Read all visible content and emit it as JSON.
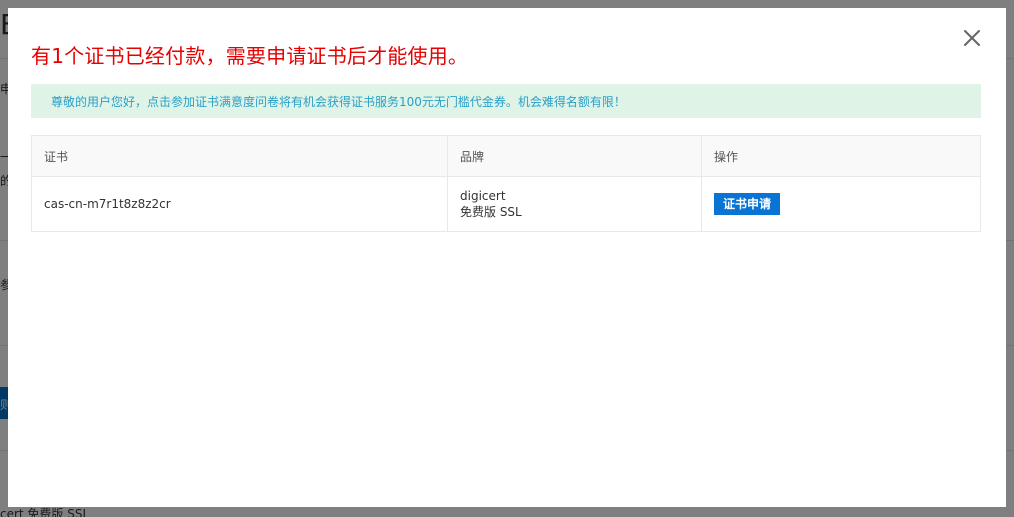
{
  "background": {
    "big_char": "E",
    "fragment_1": "申",
    "fragment_2": "一",
    "fragment_3": "的",
    "fragment_4": "参",
    "fragment_5": "则",
    "bottom_text": "cert 免费版 SSL"
  },
  "modal": {
    "title": "有1个证书已经付款，需要申请证书后才能使用。",
    "close_icon": "close-icon",
    "notice": "尊敬的用户您好，点击参加证书满意度问卷将有机会获得证书服务100元无门槛代金券。机会难得名额有限！",
    "table": {
      "headers": {
        "cert": "证书",
        "brand": "品牌",
        "action": "操作"
      },
      "rows": [
        {
          "cert": "cas-cn-m7r1t8z8z2cr",
          "brand_line1": "digicert",
          "brand_line2": "免费版 SSL",
          "action_label": "证书申请"
        }
      ]
    }
  },
  "colors": {
    "title_red": "#e60000",
    "notice_bg": "#dff3e7",
    "notice_text": "#2aa0c8",
    "button_blue": "#0a74d4"
  }
}
